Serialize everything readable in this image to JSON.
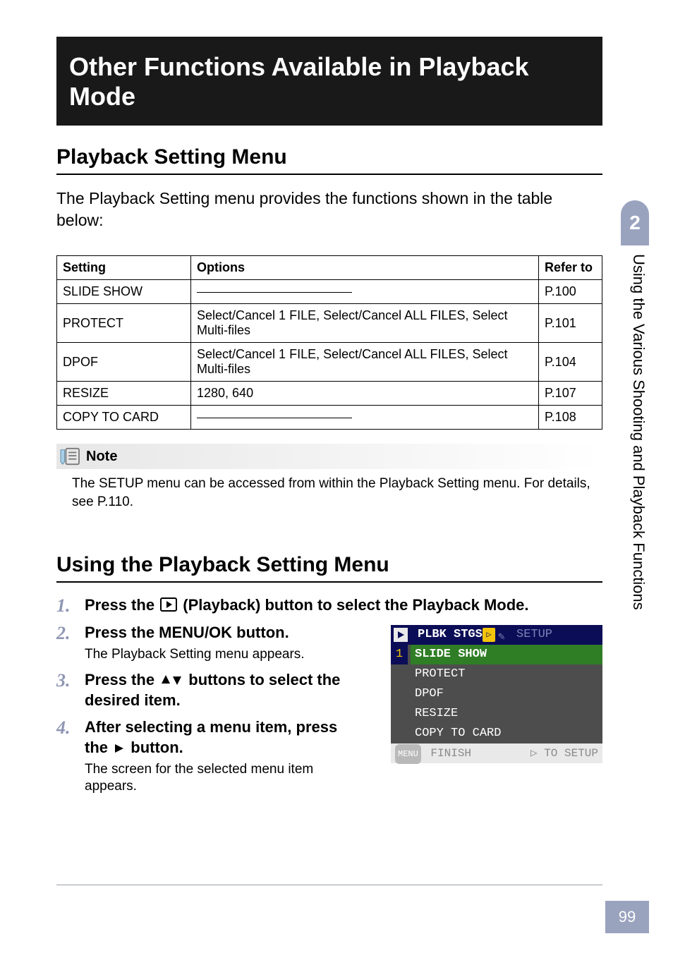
{
  "side": {
    "chapter_num": "2",
    "vertical_text": "Using the Various Shooting and Playback Functions",
    "page_number": "99"
  },
  "chapter_title": "Other Functions Available in Playback Mode",
  "section1_title": "Playback Setting Menu",
  "intro_text": "The Playback Setting menu provides the functions shown in the table below:",
  "table": {
    "headers": {
      "setting": "Setting",
      "options": "Options",
      "refer": "Refer to"
    },
    "rows": [
      {
        "setting": "SLIDE SHOW",
        "options": "",
        "refer": "P.100",
        "dash": true
      },
      {
        "setting": "PROTECT",
        "options": "Select/Cancel 1 FILE, Select/Cancel ALL FILES, Select Multi-files",
        "refer": "P.101",
        "dash": false
      },
      {
        "setting": "DPOF",
        "options": "Select/Cancel 1 FILE, Select/Cancel ALL FILES, Select Multi-files",
        "refer": "P.104",
        "dash": false
      },
      {
        "setting": "RESIZE",
        "options": "1280, 640",
        "refer": "P.107",
        "dash": false
      },
      {
        "setting": "COPY TO CARD",
        "options": "",
        "refer": "P.108",
        "dash": true
      }
    ]
  },
  "note": {
    "label": "Note",
    "body": "The SETUP menu can be accessed from within the Playback Setting menu. For details, see P.110."
  },
  "section2_title": "Using the Playback Setting Menu",
  "steps": {
    "s1": {
      "head_a": "Press the ",
      "head_b": " (Playback) button to select the Playback Mode."
    },
    "s2": {
      "head": "Press the MENU/OK button.",
      "sub": "The Playback Setting menu appears."
    },
    "s3": {
      "head_a": "Press the ",
      "head_b": " buttons to select the desired item."
    },
    "s4": {
      "head_a": "After selecting a menu item, press the ",
      "head_b": " button.",
      "sub": "The screen for the selected menu item appears."
    }
  },
  "cam": {
    "tab_active": "PLBK STGS",
    "tab_inactive": "SETUP",
    "num": "1",
    "items": [
      "SLIDE SHOW",
      "PROTECT",
      "DPOF",
      "RESIZE",
      "COPY TO CARD"
    ],
    "bottom_left": "FINISH",
    "bottom_right": "TO SETUP",
    "bottom_left_pill": "MENU"
  }
}
